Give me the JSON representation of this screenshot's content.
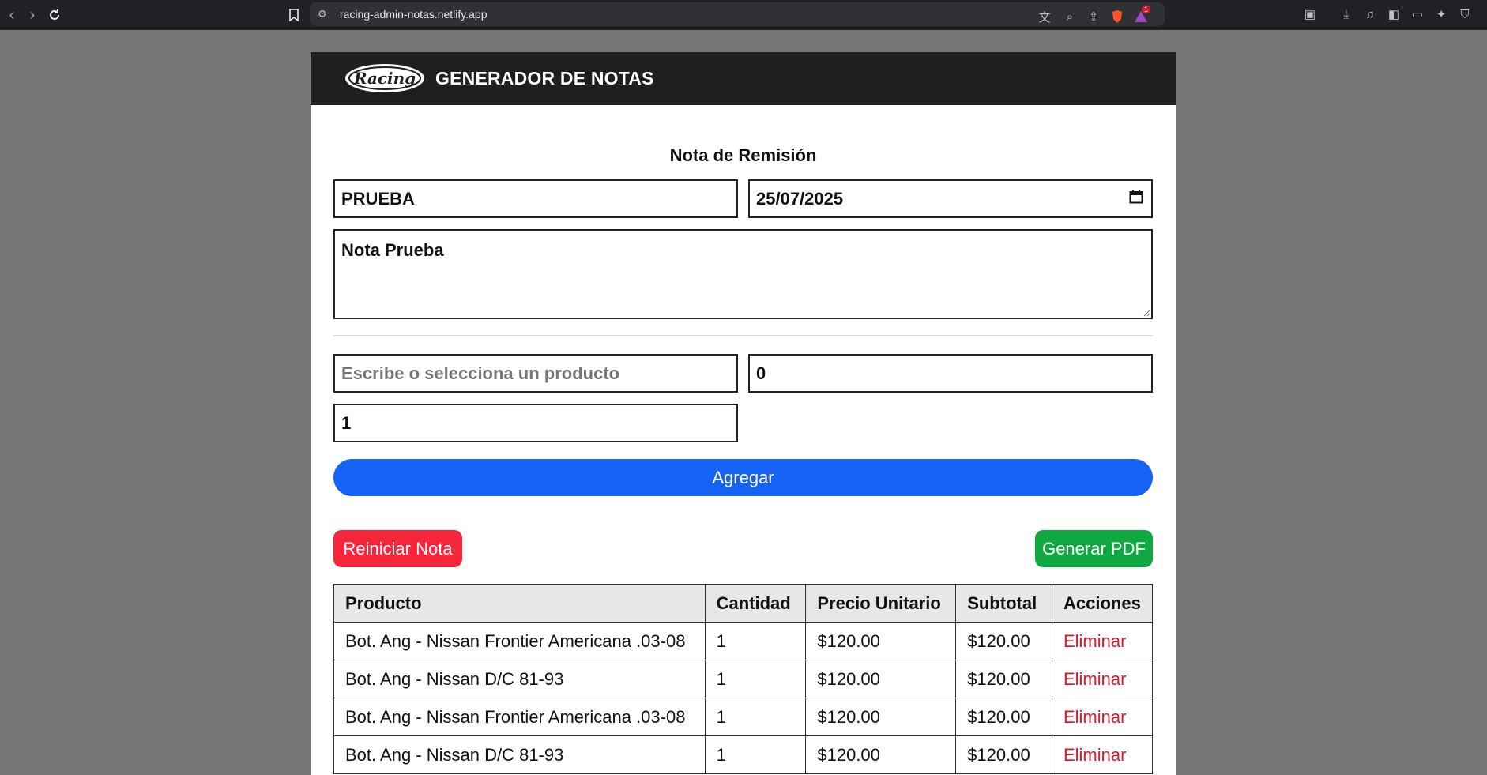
{
  "browser": {
    "url": "racing-admin-notas.netlify.app",
    "notification_count": "1"
  },
  "header": {
    "logo_text": "Racing",
    "title": "GENERADOR DE NOTAS"
  },
  "form": {
    "section_title": "Nota de Remisión",
    "client_value": "PRUEBA",
    "date_value": "25/07/2025",
    "notes_value": "Nota Prueba",
    "product_placeholder": "Escribe o selecciona un producto",
    "price_value": "0",
    "quantity_value": "1",
    "add_label": "Agregar",
    "reset_label": "Reiniciar Nota",
    "pdf_label": "Generar PDF"
  },
  "table": {
    "headers": [
      "Producto",
      "Cantidad",
      "Precio Unitario",
      "Subtotal",
      "Acciones"
    ],
    "rows": [
      {
        "product": "Bot. Ang - Nissan Frontier Americana .03-08",
        "qty": "1",
        "price": "$120.00",
        "subtotal": "$120.00",
        "action": "Eliminar"
      },
      {
        "product": "Bot. Ang - Nissan D/C 81-93",
        "qty": "1",
        "price": "$120.00",
        "subtotal": "$120.00",
        "action": "Eliminar"
      },
      {
        "product": "Bot. Ang - Nissan Frontier Americana .03-08",
        "qty": "1",
        "price": "$120.00",
        "subtotal": "$120.00",
        "action": "Eliminar"
      },
      {
        "product": "Bot. Ang - Nissan D/C 81-93",
        "qty": "1",
        "price": "$120.00",
        "subtotal": "$120.00",
        "action": "Eliminar"
      }
    ]
  },
  "colors": {
    "primary": "#1662f5",
    "danger": "#f5263c",
    "success": "#10a840",
    "header_bg": "#1f1f1f"
  }
}
